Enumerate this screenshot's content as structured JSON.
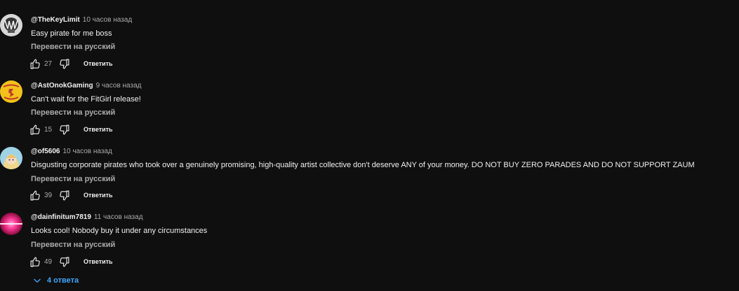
{
  "comments": [
    {
      "author": "@TheKeyLimit",
      "time": "10 часов назад",
      "text": "Easy pirate for me boss",
      "translate": "Перевести на русский",
      "likes": "27",
      "reply": "Ответить"
    },
    {
      "author": "@AstOnokGaming",
      "time": "9 часов назад",
      "text": "Can't wait for the FitGirl release!",
      "translate": "Перевести на русский",
      "likes": "15",
      "reply": "Ответить"
    },
    {
      "author": "@of5606",
      "time": "10 часов назад",
      "text": "Disgusting corporate pirates who took over a genuinely promising, high-quality artist collective don't deserve ANY of your money. DO NOT BUY ZERO PARADES AND DO NOT SUPPORT ZAUM",
      "translate": "Перевести на русский",
      "likes": "39",
      "reply": "Ответить"
    },
    {
      "author": "@dainfinitum7819",
      "time": "11 часов назад",
      "text": "Looks cool! Nobody buy it under any circumstances",
      "translate": "Перевести на русский",
      "likes": "49",
      "reply": "Ответить"
    }
  ],
  "replies_toggle": "4 ответа",
  "colors": {
    "background": "#0f0f0f",
    "text": "#f1f1f1",
    "secondary": "#aaaaaa",
    "link": "#3ea6ff"
  }
}
